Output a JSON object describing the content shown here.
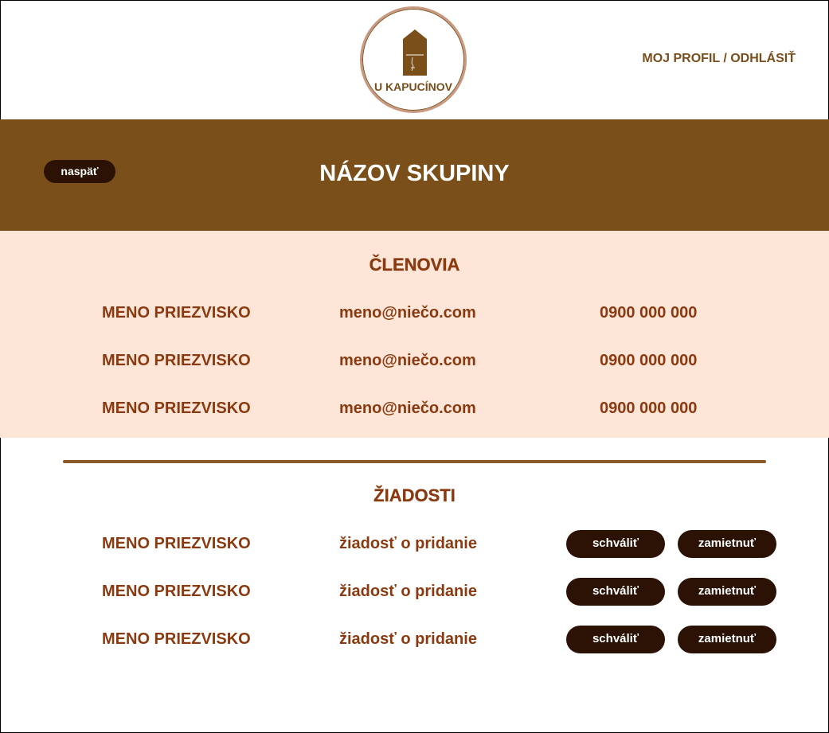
{
  "header": {
    "logo_text": "U KAPUCÍNOV",
    "profile_link": "MOJ PROFIL / ODHLÁSIŤ"
  },
  "banner": {
    "back_label": "naspäť",
    "title": "NÁZOV SKUPINY"
  },
  "members": {
    "title": "ČLENOVIA",
    "rows": [
      {
        "name": "MENO PRIEZVISKO",
        "email": "meno@niečo.com",
        "phone": "0900 000 000"
      },
      {
        "name": "MENO PRIEZVISKO",
        "email": "meno@niečo.com",
        "phone": "0900 000 000"
      },
      {
        "name": "MENO PRIEZVISKO",
        "email": "meno@niečo.com",
        "phone": "0900 000 000"
      }
    ]
  },
  "requests": {
    "title": "ŽIADOSTI",
    "approve_label": "schváliť",
    "reject_label": "zamietnuť",
    "rows": [
      {
        "name": "MENO PRIEZVISKO",
        "text": "žiadosť o pridanie"
      },
      {
        "name": "MENO PRIEZVISKO",
        "text": "žiadosť o pridanie"
      },
      {
        "name": "MENO PRIEZVISKO",
        "text": "žiadosť o pridanie"
      }
    ]
  },
  "colors": {
    "brand_brown": "#7a4f1a",
    "dark_button": "#2b1205",
    "text_brown": "#8a3a10",
    "members_bg": "#fde5d7"
  }
}
